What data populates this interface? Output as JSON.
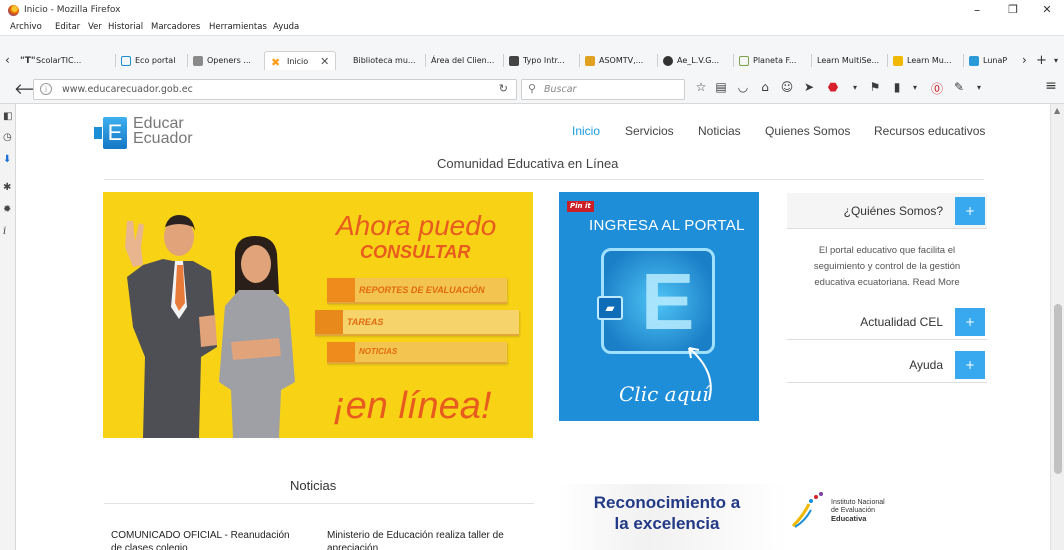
{
  "window": {
    "title": "Inicio - Mozilla Firefox",
    "controls": [
      "–",
      "❐",
      "✕"
    ]
  },
  "menubar": [
    "Archivo",
    "Editar",
    "Ver",
    "Historial",
    "Marcadores",
    "Herramientas",
    "Ayuda"
  ],
  "tabs": [
    {
      "label": "ScolarTIC...",
      "color": "#333333"
    },
    {
      "label": "Eco portal",
      "color": "#1a8fd6"
    },
    {
      "label": "Openers ...",
      "color": "#6b6b6b"
    },
    {
      "label": "Inicio",
      "color": "#ff9d1a",
      "active": true
    },
    {
      "label": "Biblioteca mu...",
      "color": ""
    },
    {
      "label": "Área del Clien...",
      "color": ""
    },
    {
      "label": "Typo Intr...",
      "color": "#444444"
    },
    {
      "label": "ASOMTV,...",
      "color": "#e0a020"
    },
    {
      "label": "Ae_L.V.G...",
      "color": "#333333"
    },
    {
      "label": "Planeta F...",
      "color": "#7aa04a"
    },
    {
      "label": "Learn MultiSe...",
      "color": ""
    },
    {
      "label": "Learn Mu...",
      "color": "#f0b800"
    },
    {
      "label": "LunaP",
      "color": "#2a9bd8"
    }
  ],
  "navbar": {
    "url": "www.educarecuador.gob.ec",
    "search_placeholder": "Buscar"
  },
  "site": {
    "logo_line1": "Educar",
    "logo_line2": "Ecuador",
    "nav": [
      "Inicio",
      "Servicios",
      "Noticias",
      "Quienes Somos",
      "Recursos educativos"
    ],
    "subtitle": "Comunidad Educativa en Línea"
  },
  "banner_yellow": {
    "line1": "Ahora puedo",
    "line2": "CONSULTAR",
    "items": [
      "REPORTES DE EVALUACIÓN",
      "TAREAS",
      "NOTICIAS"
    ],
    "footer": "¡en línea!"
  },
  "banner_blue": {
    "pin": "Pin it",
    "title": "INGRESA AL PORTAL",
    "cta": "Clic aquí"
  },
  "accordion": {
    "about_title": "¿Quiénes Somos?",
    "about_text": "El portal educativo que facilita el seguimiento y control de la gestión educativa ecuatoriana. Read More",
    "item2": "Actualidad CEL",
    "item3": "Ayuda",
    "plus": "+"
  },
  "news": {
    "title": "Noticias",
    "item1": "COMUNICADO OFICIAL - Reanudación de clases colegio",
    "item2": "Ministerio de Educación realiza taller de apreciación"
  },
  "banner_bottom": {
    "line1": "Reconocimiento a",
    "line2": "la excelencia",
    "ineval_1": "Instituto Nacional",
    "ineval_2": "de Evaluación",
    "ineval_3": "Educativa"
  }
}
